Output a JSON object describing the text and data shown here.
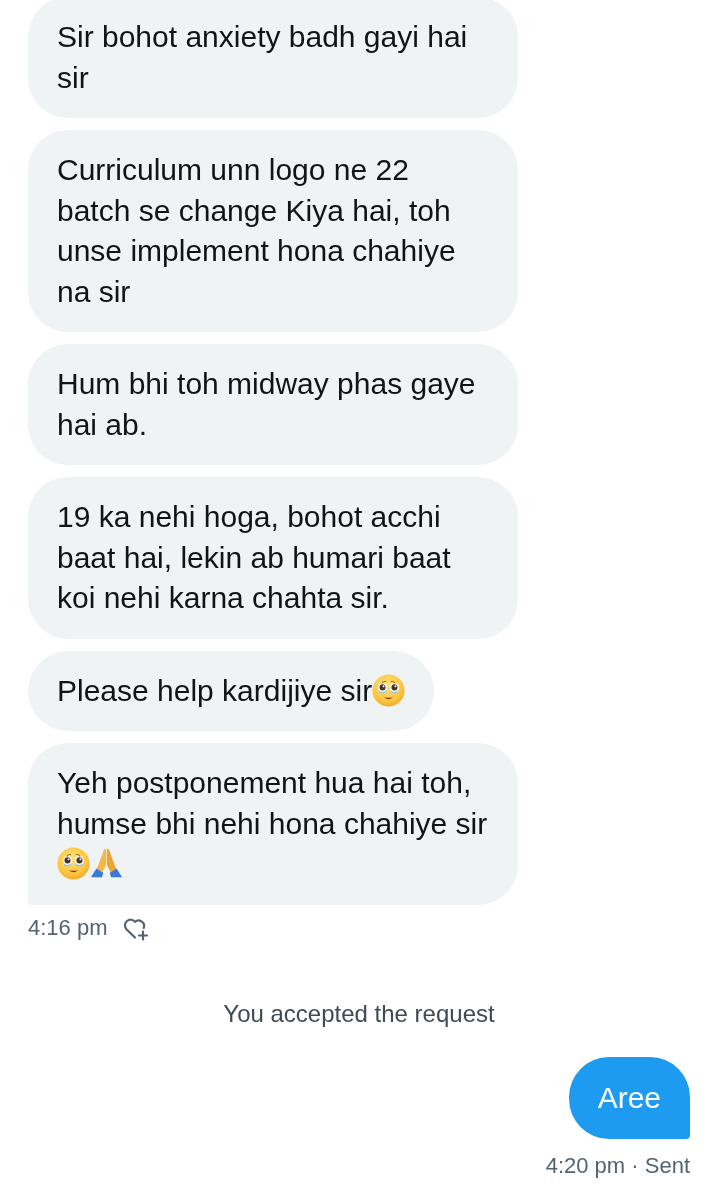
{
  "messages": [
    {
      "text": "Sir bohot anxiety badh gayi hai sir",
      "tail": false
    },
    {
      "text": "Curriculum unn logo ne 22 batch se change Kiya hai, toh unse implement hona chahiye na sir",
      "tail": false
    },
    {
      "text": "Hum bhi toh midway phas gaye hai ab.",
      "tail": false
    },
    {
      "text": "19 ka nehi hoga, bohot acchi baat hai, lekin ab humari baat koi nehi karna chahta sir.",
      "tail": false
    },
    {
      "text": "Please help kardijiye sir",
      "emojis": [
        {
          "kind": "face"
        }
      ],
      "tail": false
    },
    {
      "text": "Yeh postponement hua hai toh, humse bhi nehi hona chahiye sir",
      "emojis": [
        {
          "kind": "face"
        },
        {
          "kind": "hands"
        }
      ],
      "tail": true
    }
  ],
  "messages_meta": {
    "time": "4:16 pm"
  },
  "notice": "You accepted the request",
  "sent": [
    {
      "text": "Aree",
      "tail": true
    }
  ],
  "sent_meta": {
    "time": "4:20 pm · Sent"
  }
}
